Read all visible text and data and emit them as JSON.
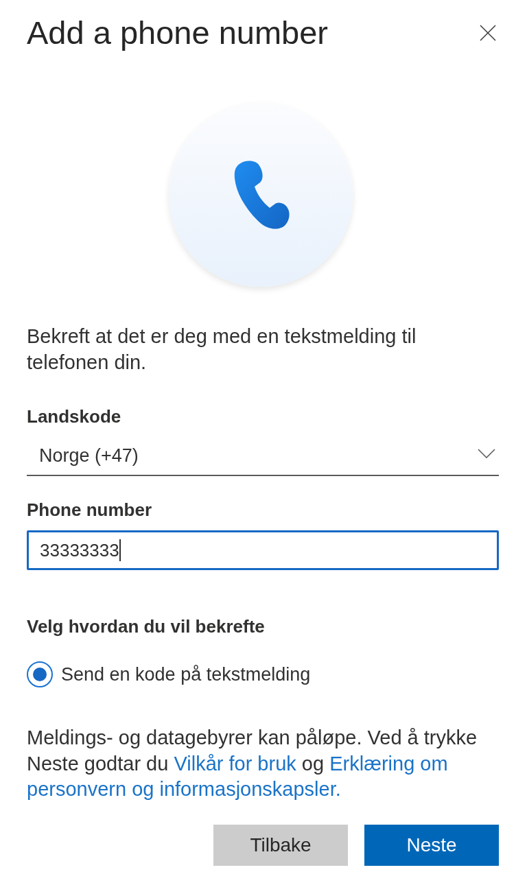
{
  "dialog": {
    "title": "Add a phone number"
  },
  "intro": "Bekreft at det er deg med en tekstmelding til telefonen din.",
  "country_code": {
    "label": "Landskode",
    "value": "Norge (+47)"
  },
  "phone_number": {
    "label": "Phone number",
    "value": "33333333",
    "focused": true
  },
  "verify_method": {
    "label": "Velg hvordan du vil bekrefte",
    "options": [
      {
        "label": "Send en kode på tekstmelding",
        "selected": true
      }
    ]
  },
  "notice": {
    "parts": [
      {
        "kind": "text",
        "text": "Meldings- og datagebyrer kan påløpe. Ved å trykke Neste godtar du"
      },
      {
        "kind": "link",
        "text": "Vilkår for bruk"
      },
      {
        "kind": "text",
        "text": "og"
      },
      {
        "kind": "link",
        "text": "Erklæring om"
      },
      {
        "kind": "link",
        "text": "personvern og informasjonskapsler."
      }
    ]
  },
  "buttons": [
    {
      "label": "Tilbake",
      "kind": "secondary"
    },
    {
      "label": "Neste",
      "kind": "primary"
    }
  ]
}
